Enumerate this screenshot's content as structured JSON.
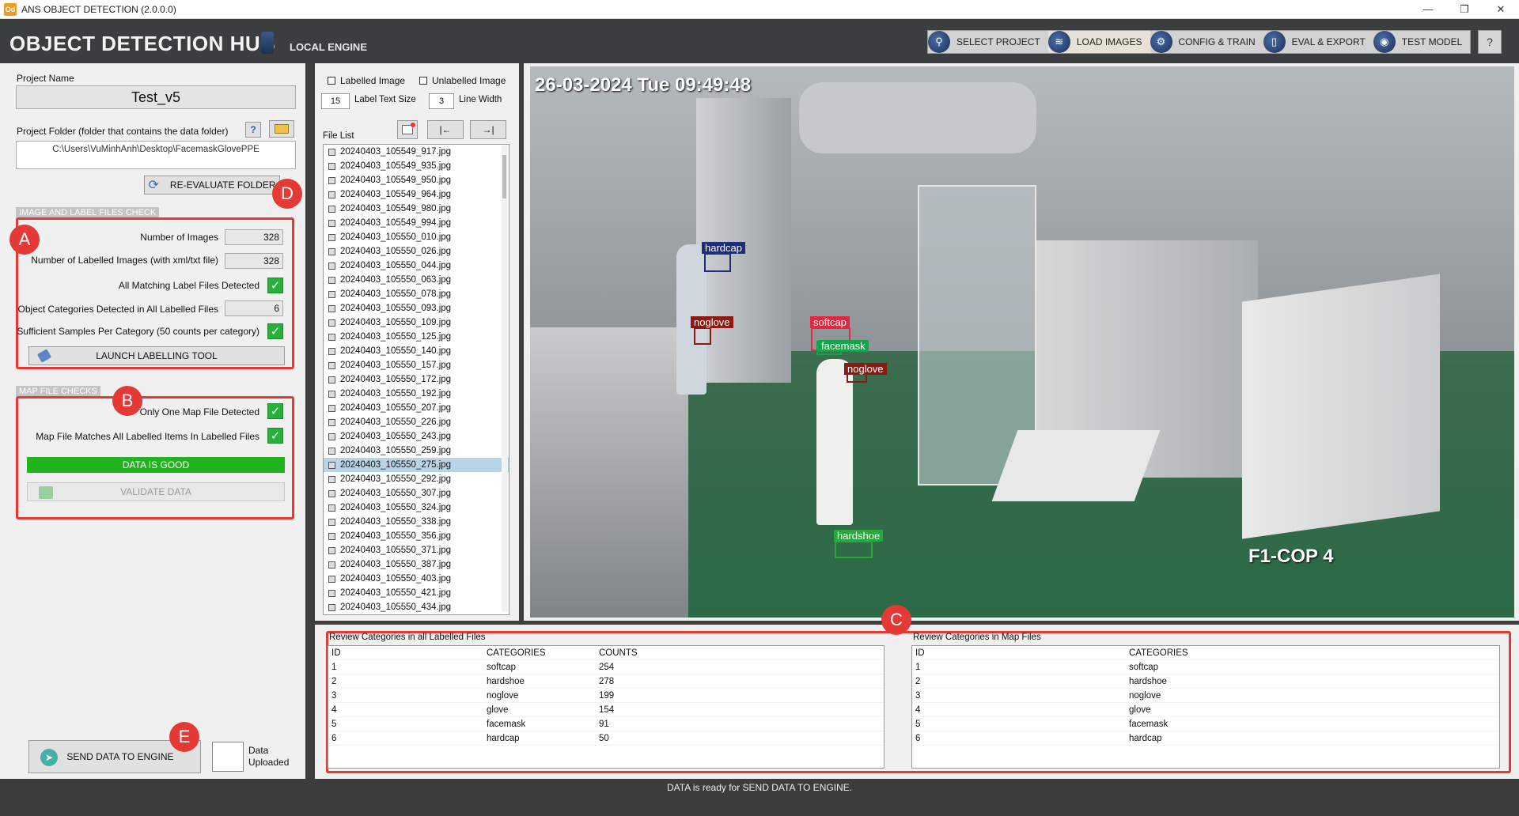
{
  "window": {
    "title": "ANS OBJECT DETECTION (2.0.0.0)",
    "logo_text": "Od",
    "minimize": "—",
    "maximize": "❐",
    "close": "✕"
  },
  "header": {
    "app_title": "OBJECT DETECTION HUB",
    "engine_label": "LOCAL ENGINE",
    "nav": [
      {
        "label": "SELECT PROJECT",
        "icon": "magnifier-icon",
        "glyph": "⚲"
      },
      {
        "label": "LOAD IMAGES",
        "icon": "layers-icon",
        "glyph": "≋"
      },
      {
        "label": "CONFIG & TRAIN",
        "icon": "gear-icon",
        "glyph": "⚙"
      },
      {
        "label": "EVAL & EXPORT",
        "icon": "document-icon",
        "glyph": "▯"
      },
      {
        "label": "TEST MODEL",
        "icon": "globe-icon",
        "glyph": "◉"
      }
    ],
    "help": "?"
  },
  "left": {
    "project_name_label": "Project Name",
    "project_name": "Test_v5",
    "project_folder_label": "Project Folder (folder that contains the data folder)",
    "project_folder": "C:\\Users\\VuMinhAnh\\Desktop\\FacemaskGlovePPE",
    "folder_help": "?",
    "reevaluate": "RE-EVALUATE FOLDER",
    "section_files": "IMAGE AND LABEL FILES CHECK",
    "num_images_label": "Number of Images",
    "num_images": "328",
    "num_labelled_label": "Number of Labelled Images (with xml/txt file)",
    "num_labelled": "328",
    "all_matching_label": "All Matching Label Files Detected",
    "categories_label": "Object Categories Detected in All Labelled Files",
    "categories_count": "6",
    "sufficient_label": "Sufficient Samples Per Category (50 counts per category)",
    "launch_tool": "LAUNCH LABELLING TOOL",
    "section_map": "MAP FILE CHECKS",
    "one_map_label": "Only One Map File Detected",
    "map_matches_label": "Map File Matches All Labelled Items In Labelled Files",
    "data_good": "DATA IS GOOD",
    "validate": "VALIDATE DATA",
    "send": "SEND DATA TO ENGINE",
    "uploaded": "Data Uploaded"
  },
  "annotations": {
    "a": "A",
    "b": "B",
    "c": "C",
    "d": "D",
    "e": "E"
  },
  "mid": {
    "labelled_image": "Labelled Image",
    "unlabelled_image": "Unlabelled Image",
    "label_text_size": "15",
    "label_text_size_label": "Label Text Size",
    "line_width": "3",
    "line_width_label": "Line Width",
    "file_list_label": "File List",
    "first_btn": "|←",
    "last_btn": "→|",
    "selected_index": 22,
    "files": [
      "20240403_105549_917.jpg",
      "20240403_105549_935.jpg",
      "20240403_105549_950.jpg",
      "20240403_105549_964.jpg",
      "20240403_105549_980.jpg",
      "20240403_105549_994.jpg",
      "20240403_105550_010.jpg",
      "20240403_105550_026.jpg",
      "20240403_105550_044.jpg",
      "20240403_105550_063.jpg",
      "20240403_105550_078.jpg",
      "20240403_105550_093.jpg",
      "20240403_105550_109.jpg",
      "20240403_105550_125.jpg",
      "20240403_105550_140.jpg",
      "20240403_105550_157.jpg",
      "20240403_105550_172.jpg",
      "20240403_105550_192.jpg",
      "20240403_105550_207.jpg",
      "20240403_105550_226.jpg",
      "20240403_105550_243.jpg",
      "20240403_105550_259.jpg",
      "20240403_105550_275.jpg",
      "20240403_105550_292.jpg",
      "20240403_105550_307.jpg",
      "20240403_105550_324.jpg",
      "20240403_105550_338.jpg",
      "20240403_105550_356.jpg",
      "20240403_105550_371.jpg",
      "20240403_105550_387.jpg",
      "20240403_105550_403.jpg",
      "20240403_105550_421.jpg",
      "20240403_105550_434.jpg"
    ]
  },
  "image": {
    "timestamp": "26-03-2024 Tue 09:49:48",
    "camera": "F1-COP 4",
    "detections": [
      {
        "label": "hardcap",
        "color": "#1f2d7a"
      },
      {
        "label": "noglove",
        "color": "#8b1a10"
      },
      {
        "label": "softcap",
        "color": "#e0283e"
      },
      {
        "label": "facemask",
        "color": "#17a34a"
      },
      {
        "label": "noglove",
        "color": "#8b1a10"
      },
      {
        "label": "hardshoe",
        "color": "#26a83a"
      }
    ]
  },
  "review_labelled": {
    "title": "Review Categories in all Labelled Files",
    "headers": [
      "ID",
      "CATEGORIES",
      "COUNTS"
    ],
    "rows": [
      [
        "1",
        "softcap",
        "254"
      ],
      [
        "2",
        "hardshoe",
        "278"
      ],
      [
        "3",
        "noglove",
        "199"
      ],
      [
        "4",
        "glove",
        "154"
      ],
      [
        "5",
        "facemask",
        "91"
      ],
      [
        "6",
        "hardcap",
        "50"
      ]
    ]
  },
  "review_map": {
    "title": "Review Categories in Map Files",
    "headers": [
      "ID",
      "CATEGORIES"
    ],
    "rows": [
      [
        "1",
        "softcap"
      ],
      [
        "2",
        "hardshoe"
      ],
      [
        "3",
        "noglove"
      ],
      [
        "4",
        "glove"
      ],
      [
        "5",
        "facemask"
      ],
      [
        "6",
        "hardcap"
      ]
    ]
  },
  "status": "DATA is ready for SEND DATA TO ENGINE.",
  "colors": {
    "good": "#22b41e",
    "alert": "#e53935",
    "selected_row": "#b9d4e5"
  }
}
